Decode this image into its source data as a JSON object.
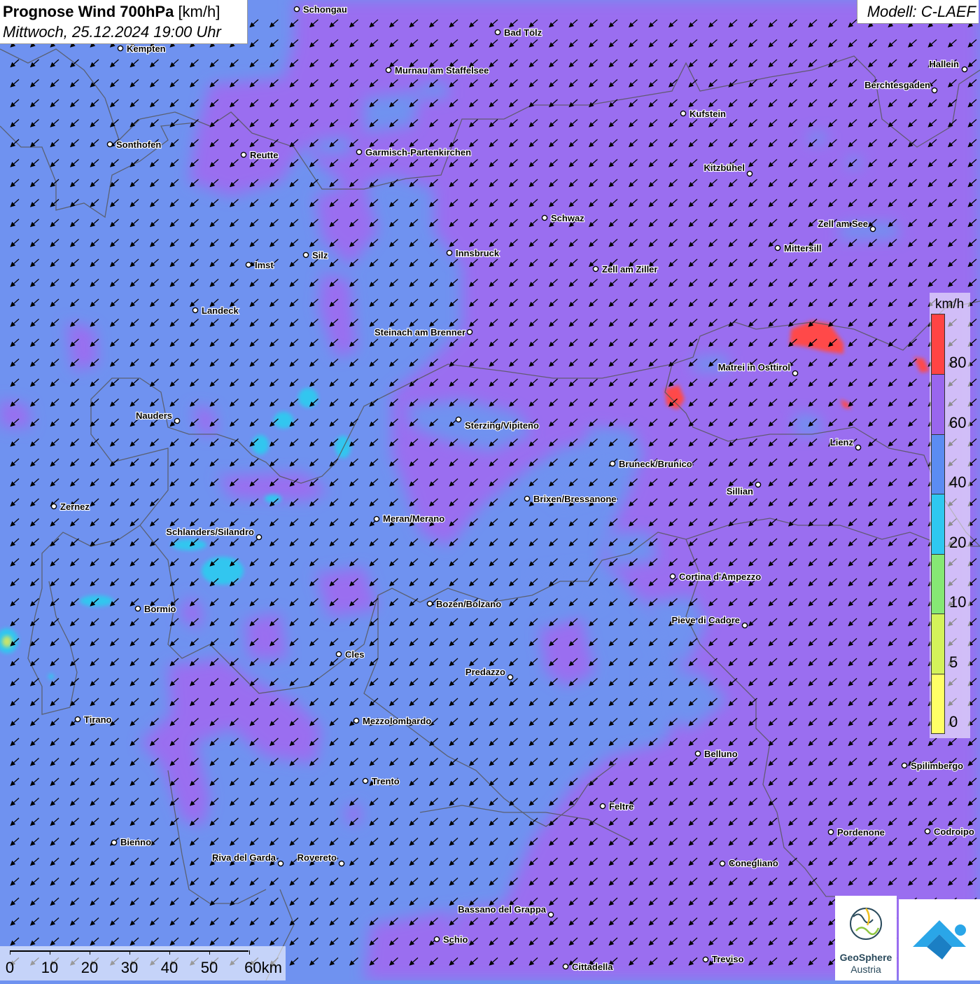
{
  "header": {
    "title": "Prognose Wind 700hPa",
    "unit": "[km/h]",
    "datetime": "Mittwoch, 25.12.2024 19:00 Uhr",
    "model": "Modell: C-LAEF"
  },
  "legend": {
    "unit": "km/h",
    "bins": [
      {
        "label": "0",
        "color": "#ffff66"
      },
      {
        "label": "5",
        "color": "#d4f25a"
      },
      {
        "label": "10",
        "color": "#86e874"
      },
      {
        "label": "20",
        "color": "#2ec8f0"
      },
      {
        "label": "40",
        "color": "#5b8cf2"
      },
      {
        "label": "60",
        "color": "#9966ee"
      },
      {
        "label": "80",
        "color": "#ff4444"
      }
    ]
  },
  "scalebar": {
    "labels": [
      "0",
      "10",
      "20",
      "30",
      "40",
      "50",
      "60km"
    ]
  },
  "logos": {
    "geosphere_line1": "GeoSphere",
    "geosphere_line2": "Austria"
  },
  "wind": {
    "direction": "north-east wind, arrows pointing south-west"
  },
  "cities": [
    {
      "name": "Schongau"
    },
    {
      "name": "Bad Tölz"
    },
    {
      "name": "Kempten"
    },
    {
      "name": "Murnau am Staffelsee"
    },
    {
      "name": "Hallein"
    },
    {
      "name": "Berchtesgaden"
    },
    {
      "name": "Kufstein"
    },
    {
      "name": "Sonthofen"
    },
    {
      "name": "Reutte"
    },
    {
      "name": "Garmisch-Partenkirchen"
    },
    {
      "name": "Kitzbühel"
    },
    {
      "name": "Schwaz"
    },
    {
      "name": "Zell am See"
    },
    {
      "name": "Mittersill"
    },
    {
      "name": "Innsbruck"
    },
    {
      "name": "Silz"
    },
    {
      "name": "Imst"
    },
    {
      "name": "Zell am Ziller"
    },
    {
      "name": "Landeck"
    },
    {
      "name": "Steinach am Brenner"
    },
    {
      "name": "Matrei in Osttirol"
    },
    {
      "name": "Nauders"
    },
    {
      "name": "Sterzing/Vipiteno"
    },
    {
      "name": "Lienz"
    },
    {
      "name": "Bruneck/Brunico"
    },
    {
      "name": "Sillian"
    },
    {
      "name": "Zernez"
    },
    {
      "name": "Brixen/Bressanone"
    },
    {
      "name": "Meran/Merano"
    },
    {
      "name": "Schlanders/Silandro"
    },
    {
      "name": "Cortina d'Ampezzo"
    },
    {
      "name": "Bozen/Bolzano"
    },
    {
      "name": "Bormio"
    },
    {
      "name": "Pieve di Cadore"
    },
    {
      "name": "Cles"
    },
    {
      "name": "Predazzo"
    },
    {
      "name": "Tirano"
    },
    {
      "name": "Mezzolombardo"
    },
    {
      "name": "Belluno"
    },
    {
      "name": "Spilimbergo"
    },
    {
      "name": "Trento"
    },
    {
      "name": "Feltre"
    },
    {
      "name": "Pordenone"
    },
    {
      "name": "Codroipo"
    },
    {
      "name": "Bienno"
    },
    {
      "name": "Riva del Garda"
    },
    {
      "name": "Rovereto"
    },
    {
      "name": "Conegliano"
    },
    {
      "name": "Bassano del Grappa"
    },
    {
      "name": "Schio"
    },
    {
      "name": "Treviso"
    },
    {
      "name": "Cittadella"
    }
  ]
}
